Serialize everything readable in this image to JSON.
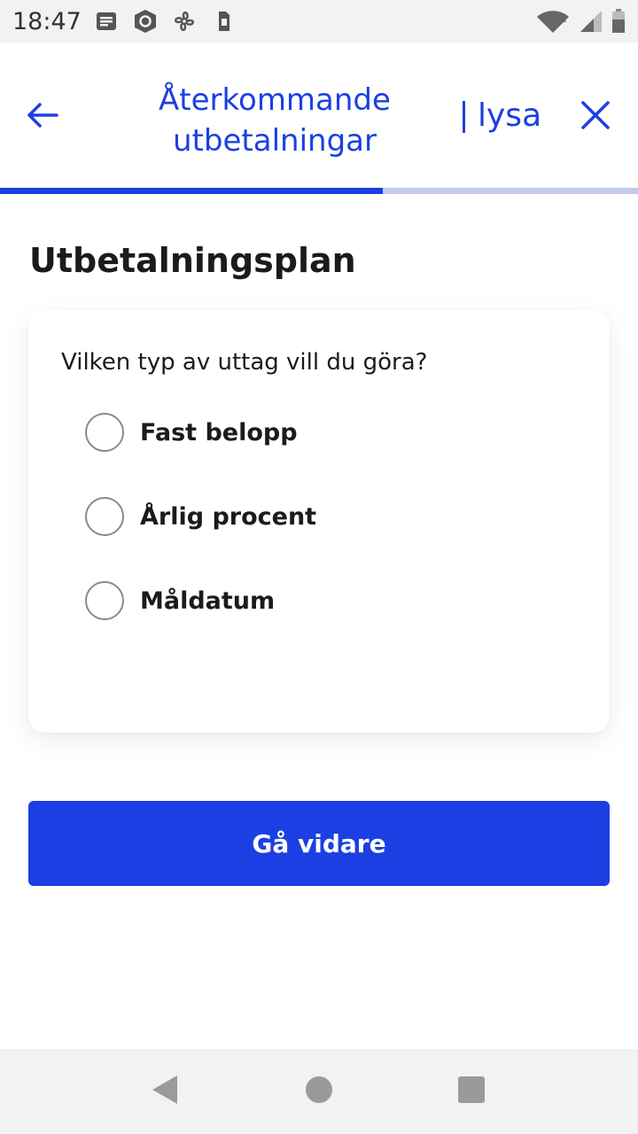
{
  "status_bar": {
    "time": "18:47",
    "left_icons": [
      "notes-icon",
      "shield-app-icon",
      "fan-icon",
      "sim-icon"
    ],
    "right_icons": [
      "wifi-icon",
      "signal-icon",
      "battery-icon"
    ]
  },
  "header": {
    "title": "Återkommande utbetalningar",
    "logo": "lysa",
    "back_icon": "arrow-left-icon",
    "close_icon": "close-icon"
  },
  "progress": {
    "fraction": 0.6
  },
  "main": {
    "heading": "Utbetalningsplan",
    "question": "Vilken typ av uttag vill du göra?",
    "options": [
      {
        "label": "Fast belopp",
        "selected": false
      },
      {
        "label": "Årlig procent",
        "selected": false
      },
      {
        "label": "Måldatum",
        "selected": false
      }
    ],
    "continue_label": "Gå vidare"
  },
  "colors": {
    "accent": "#1b3fe3",
    "progress_track": "#c3c9ec"
  },
  "nav_bar": {
    "icons": [
      "back-triangle-icon",
      "home-circle-icon",
      "recents-square-icon"
    ]
  }
}
